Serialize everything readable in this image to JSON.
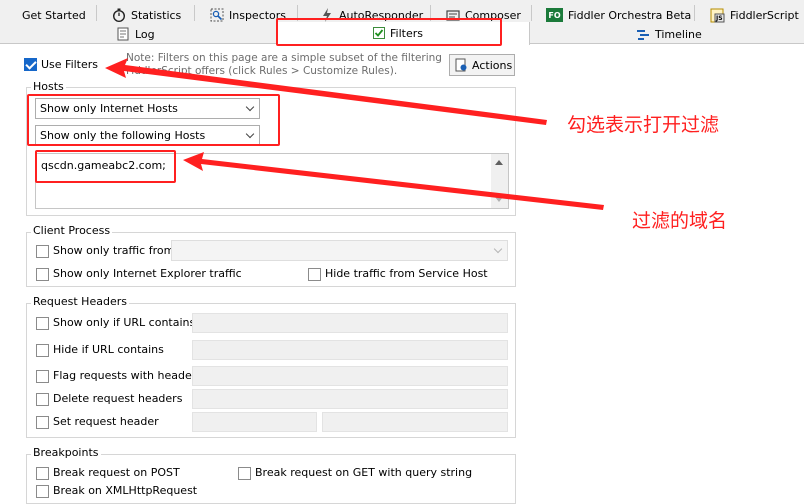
{
  "tabs": {
    "row1": [
      {
        "label": "Get Started",
        "icon": "none"
      },
      {
        "label": "Statistics",
        "icon": "stopwatch-icon"
      },
      {
        "label": "Inspectors",
        "icon": "inspectors-icon"
      },
      {
        "label": "AutoResponder",
        "icon": "lightning-icon"
      },
      {
        "label": "Composer",
        "icon": "composer-icon"
      },
      {
        "label": "Fiddler Orchestra Beta",
        "icon": "fo-icon",
        "icon_text": "FO"
      },
      {
        "label": "FiddlerScript",
        "icon": "fiddlerscript-icon",
        "icon_text": "JS"
      }
    ],
    "row2": [
      {
        "label": "Log",
        "icon": "log-icon"
      },
      {
        "label": "Filters",
        "icon": "checkbox-icon",
        "selected": true
      },
      {
        "label": "Timeline",
        "icon": "timeline-icon"
      }
    ]
  },
  "use_filters": {
    "label": "Use Filters",
    "checked": true
  },
  "note": {
    "line1": "Note: Filters on this page are a simple subset of the filtering",
    "line2": "FiddlerScript offers (click Rules > Customize Rules)."
  },
  "actions_button": {
    "label": "Actions"
  },
  "hosts": {
    "title": "Hosts",
    "zone_select": "Show only Internet Hosts",
    "host_select": "Show only the following Hosts",
    "host_list": "qscdn.gameabc2.com;"
  },
  "client_process": {
    "title": "Client Process",
    "only_traffic_from": "Show only traffic from",
    "only_ie": "Show only Internet Explorer traffic",
    "hide_service_host": "Hide traffic from Service Host"
  },
  "request_headers": {
    "title": "Request Headers",
    "items": [
      "Show only if URL contains",
      "Hide if URL contains",
      "Flag requests with headers",
      "Delete request headers",
      "Set request header"
    ]
  },
  "breakpoints": {
    "title": "Breakpoints",
    "post": "Break request on POST",
    "get_query": "Break request on GET with query string",
    "xhr": "Break on XMLHttpRequest"
  },
  "annotations": {
    "enable_filter": "勾选表示打开过滤",
    "filtered_domain": "过滤的域名"
  },
  "colors": {
    "accent": "#1667c9",
    "annotation_red": "#ff2020",
    "fo_badge": "#1b7a3a"
  }
}
